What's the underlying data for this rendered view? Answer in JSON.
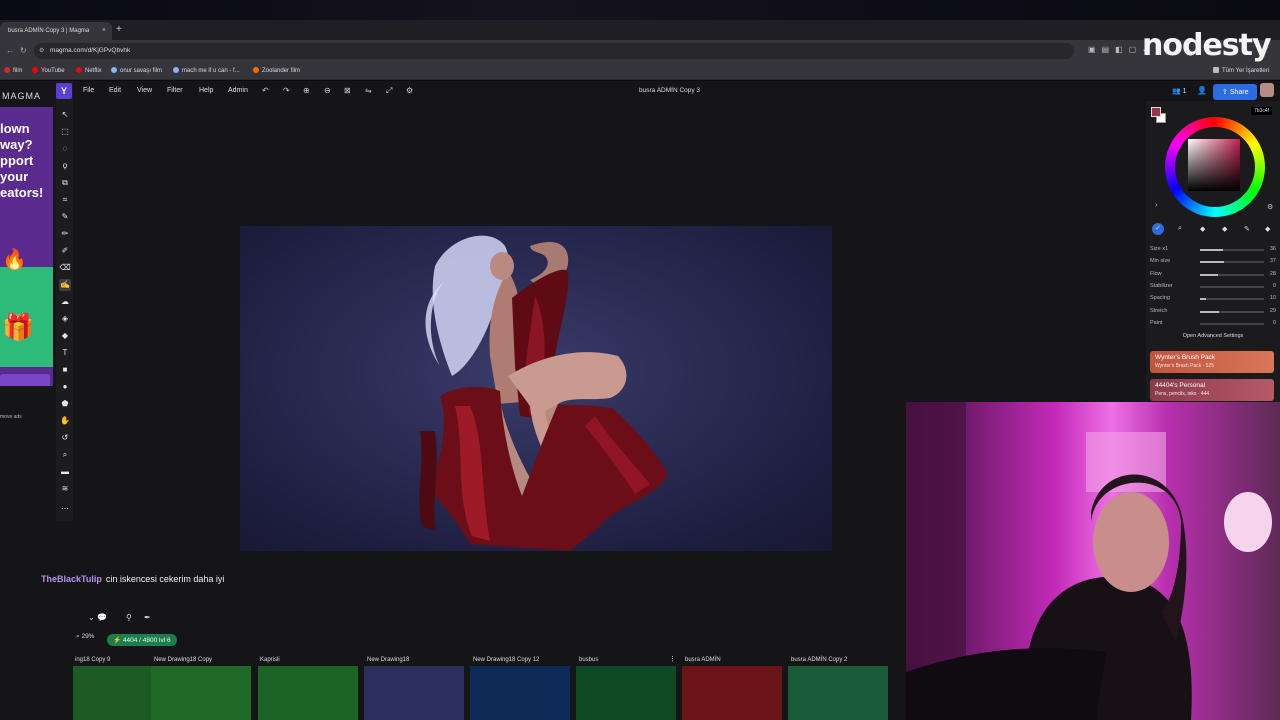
{
  "browser": {
    "tab_title": "busra ADMİN Copy 3 | Magma",
    "tab_close": "×",
    "new_tab": "+",
    "url": "magma.com/d/KjGPvQbvhk",
    "bookmarks": [
      {
        "label": "film",
        "color": "#cc2b2b"
      },
      {
        "label": "YouTube",
        "color": "#ff0000"
      },
      {
        "label": "Netflix",
        "color": "#e50914"
      },
      {
        "label": "onur savaşı film",
        "color": "#8ab4f8"
      },
      {
        "label": "mach me if u can - f...",
        "color": "#8ab4f8"
      },
      {
        "label": "Zoolander film",
        "color": "#e8710a"
      }
    ],
    "all_bookmarks": "Tüm Yer İşaretleri"
  },
  "overlay": {
    "logo": "nodesty"
  },
  "ad": {
    "brand": "MAGMA",
    "headline": "lown way? pport your eators!",
    "remove_ads": "move ads"
  },
  "menu": {
    "app_letter": "Y",
    "items": [
      "File",
      "Edit",
      "View",
      "Filter",
      "Help",
      "Admin"
    ],
    "document_title": "busra ADMİN Copy 3",
    "users_count": "1",
    "share": "Share"
  },
  "brush": {
    "color_hex": "7b3c4f",
    "colors": {
      "primary": "#a0304a",
      "secondary": "#ffffff"
    },
    "sliders": [
      {
        "label": "Size x1",
        "value": "36",
        "fraction": 0.36
      },
      {
        "label": "Min size",
        "value": "37",
        "fraction": 0.37
      },
      {
        "label": "Flow",
        "value": "28",
        "fraction": 0.28
      },
      {
        "label": "Stabilizer",
        "value": "0",
        "fraction": 0.0
      },
      {
        "label": "Spacing",
        "value": "10",
        "fraction": 0.1
      },
      {
        "label": "Stretch",
        "value": "29",
        "fraction": 0.29
      },
      {
        "label": "Paint",
        "value": "0",
        "fraction": 0.0
      }
    ],
    "advanced": "Open Advanced Settings",
    "packs": [
      {
        "name": "Wynter's Brush Pack",
        "sub": "Wynter's Brush Pack · 525"
      },
      {
        "name": "44404's Personal",
        "sub": "Pens, pencils, inks · 444"
      }
    ]
  },
  "chat": {
    "user": "TheBlackTulip",
    "message": "cin iskencesi cekerim daha iyi"
  },
  "status": {
    "zoom": "29%",
    "pixels": "4404 / 4800  lvl 6"
  },
  "drawings": [
    {
      "title": "ing18 Copy 9",
      "color": "#1d5b24"
    },
    {
      "title": "New Drawing18 Copy",
      "color": "#1e6a26"
    },
    {
      "title": "Kaprisli",
      "color": "#1c6424"
    },
    {
      "title": "New Drawing18",
      "color": "#2a2f5e"
    },
    {
      "title": "New Drawing18 Copy 12",
      "color": "#0e2a56"
    },
    {
      "title": "busbus",
      "color": "#0f4a26"
    },
    {
      "title": "busra ADMİN",
      "color": "#6a1418"
    },
    {
      "title": "busra ADMİN Copy 2",
      "color": "#1a5c3a"
    }
  ]
}
